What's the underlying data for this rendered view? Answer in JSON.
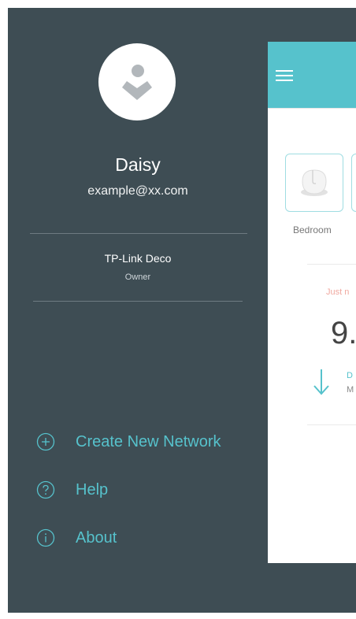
{
  "user": {
    "name": "Daisy",
    "email": "example@xx.com"
  },
  "network": {
    "name": "TP-Link Deco",
    "role": "Owner"
  },
  "menu": [
    {
      "label": "Create New Network",
      "icon": "plus-circle-icon"
    },
    {
      "label": "Help",
      "icon": "question-circle-icon"
    },
    {
      "label": "About",
      "icon": "info-circle-icon"
    }
  ],
  "background_app": {
    "device_label": "Bedroom",
    "status_text": "Just n",
    "speed_value": "9.",
    "speed_label": "D",
    "speed_unit": "M"
  },
  "colors": {
    "drawer_background": "#3e4d54",
    "accent": "#56c2cc",
    "text_primary": "#ffffff"
  }
}
